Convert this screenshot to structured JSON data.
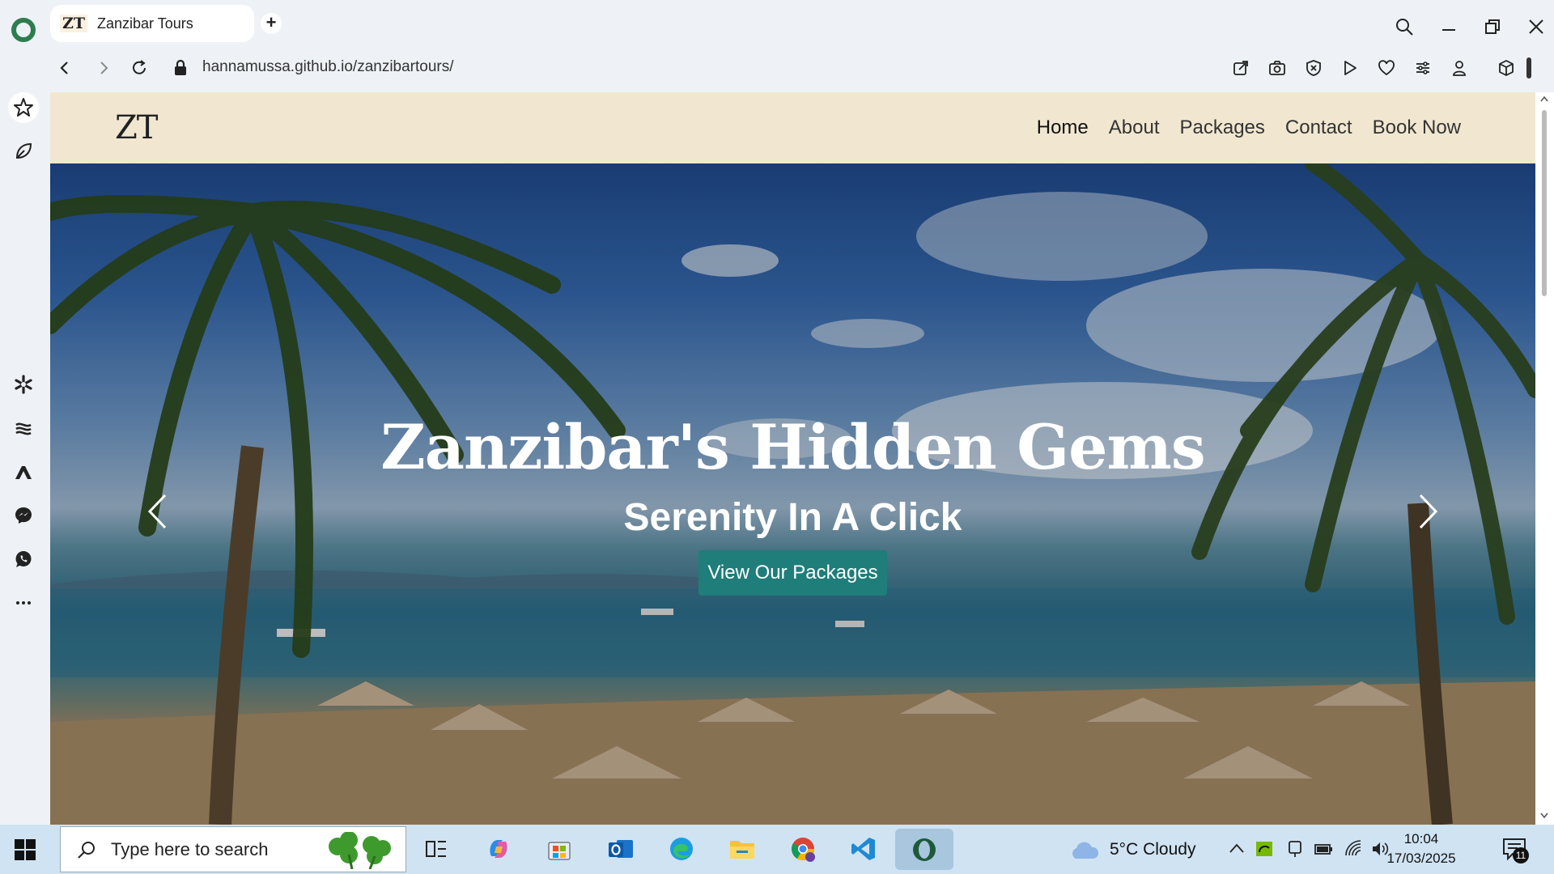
{
  "browser": {
    "tab_title": "Zanzibar Tours",
    "favicon_text": "ZT",
    "url": "hannamussa.github.io/zanzibartours/"
  },
  "site": {
    "logo": "ZT",
    "nav": [
      "Home",
      "About",
      "Packages",
      "Contact",
      "Book Now"
    ],
    "hero_title": "Zanzibar's Hidden Gems",
    "hero_subtitle": "Serenity In A Click",
    "hero_button": "View Our Packages"
  },
  "taskbar": {
    "search_placeholder": "Type here to search",
    "weather": "5°C  Cloudy",
    "time": "10:04",
    "date": "17/03/2025",
    "notifications": "11"
  },
  "colors": {
    "header_bg": "#f1e7d0",
    "button_bg": "#1f7d7a",
    "taskbar_bg": "#cfe3f3"
  }
}
